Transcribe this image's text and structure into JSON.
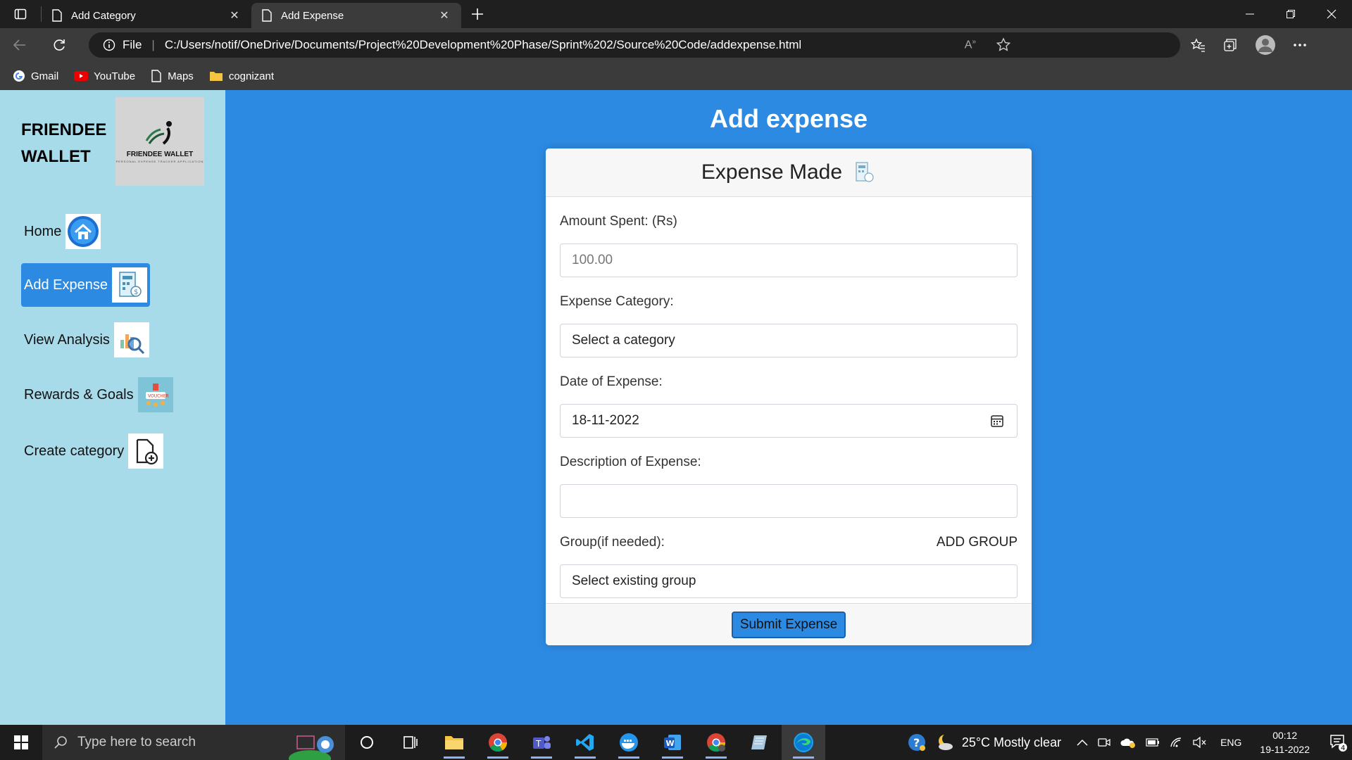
{
  "browser": {
    "tabs": [
      {
        "title": "Add Category",
        "active": false
      },
      {
        "title": "Add Expense",
        "active": true
      }
    ],
    "address": {
      "scheme_label": "File",
      "url": "C:/Users/notif/OneDrive/Documents/Project%20Development%20Phase/Sprint%202/Source%20Code/addexpense.html"
    },
    "bookmarks": [
      {
        "label": "Gmail",
        "icon": "google-icon"
      },
      {
        "label": "YouTube",
        "icon": "youtube-icon"
      },
      {
        "label": "Maps",
        "icon": "page-icon"
      },
      {
        "label": "cognizant",
        "icon": "folder-icon"
      }
    ]
  },
  "sidebar": {
    "brand_line1": "FRIENDEE",
    "brand_line2": "WALLET",
    "logo_text": "FRIENDEE WALLET",
    "logo_subtext": "PERSONAL EXPENSE TRACKER APPLICATION",
    "items": [
      {
        "label": "Home",
        "icon": "home-icon",
        "active": false
      },
      {
        "label": "Add Expense",
        "icon": "expense-icon",
        "active": true
      },
      {
        "label": "View Analysis",
        "icon": "analysis-icon",
        "active": false
      },
      {
        "label": "Rewards & Goals",
        "icon": "rewards-icon",
        "active": false
      },
      {
        "label": "Create category",
        "icon": "add-file-icon",
        "active": false
      }
    ]
  },
  "main": {
    "title": "Add expense",
    "card": {
      "header": "Expense Made",
      "amount_label": "Amount Spent: (Rs)",
      "amount_placeholder": "100.00",
      "category_label": "Expense Category:",
      "category_value": "Select a category",
      "date_label": "Date of Expense:",
      "date_value": "18-11-2022",
      "description_label": "Description of Expense:",
      "description_value": "",
      "group_label": "Group(if needed):",
      "add_group_label": "ADD GROUP",
      "group_value": "Select existing group",
      "submit_label": "Submit Expense"
    }
  },
  "taskbar": {
    "search_placeholder": "Type here to search",
    "weather": "25°C  Mostly clear",
    "language": "ENG",
    "time": "00:12",
    "date": "19-11-2022",
    "notification_count": "4"
  },
  "colors": {
    "page_bg": "#2d8ae3",
    "sidebar_bg": "#a8dbea",
    "active_nav": "#2d8ae3",
    "chrome_dark": "#1f1f1f",
    "chrome_mid": "#3b3b3b"
  }
}
